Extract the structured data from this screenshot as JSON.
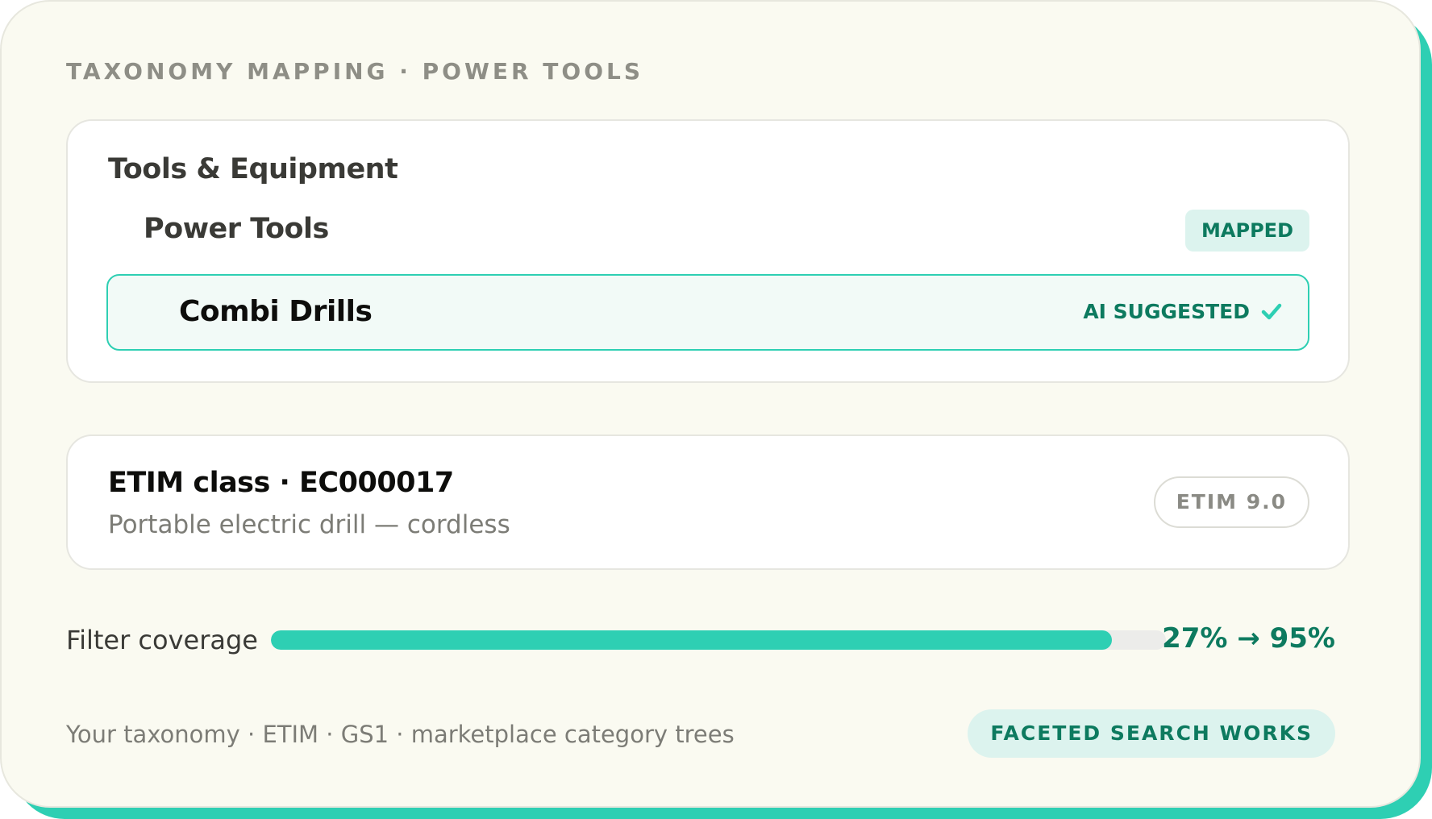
{
  "header": {
    "eyebrow": "TAXONOMY MAPPING · POWER TOOLS"
  },
  "tree": {
    "level1": "Tools & Equipment",
    "level2": "Power Tools",
    "level2_badge": "MAPPED",
    "leaf": "Combi Drills",
    "leaf_badge": "AI SUGGESTED",
    "leaf_status_icon": "check-icon"
  },
  "etim": {
    "title": "ETIM class · EC000017",
    "description": "Portable electric drill — cordless",
    "version": "ETIM 9.0"
  },
  "coverage": {
    "label": "Filter coverage",
    "value_text": "27% → 95%",
    "fill_percent": 94
  },
  "footer": {
    "text": "Your taxonomy · ETIM · GS1 · marketplace category trees",
    "badge": "FACETED SEARCH WORKS"
  },
  "colors": {
    "accent": "#2ecfb3",
    "accent_dark": "#0d7a5f",
    "badge_bg": "#dcf3ee",
    "card_bg": "#fafaf1"
  }
}
